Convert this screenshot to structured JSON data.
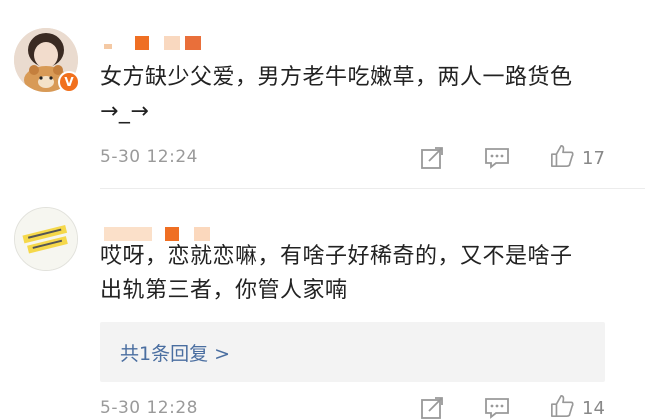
{
  "comments": [
    {
      "text": "女方缺少父爱，男方老牛吃嫩草，两人一路货色→_→",
      "time": "5-30 12:24",
      "likes": "17",
      "verified_badge": "V"
    },
    {
      "text": "哎呀，恋就恋嘛，有啥子好稀奇的，又不是啥子出轨第三者，你管人家喃",
      "time": "5-30 12:28",
      "likes": "14",
      "reply_link": "共1条回复 >"
    }
  ],
  "colors": {
    "accent": "#f1701d",
    "link": "#4a6ea0",
    "meta": "#9a9a9a"
  }
}
